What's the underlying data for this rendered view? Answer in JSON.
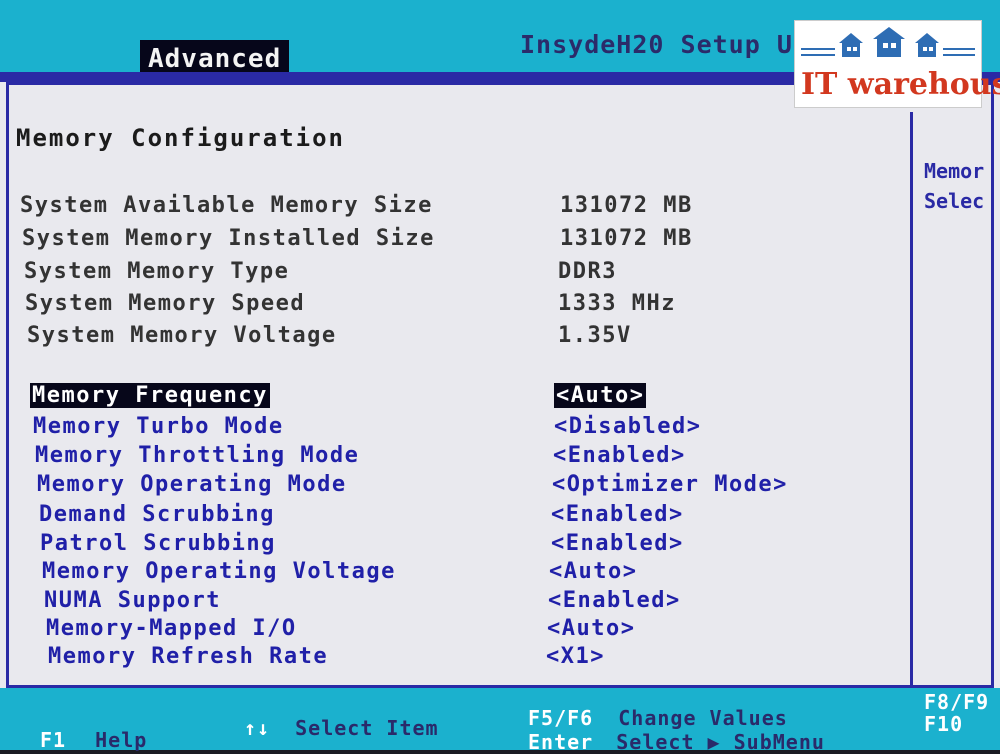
{
  "header": {
    "active_tab": "Advanced",
    "title": "InsydeH20 Setup U"
  },
  "page": {
    "section_title": "Memory Configuration",
    "help_line1": "Memor",
    "help_line2": "Selec"
  },
  "info": [
    {
      "label": "System Available Memory Size",
      "value": "131072 MB"
    },
    {
      "label": "System Memory Installed Size",
      "value": "131072 MB"
    },
    {
      "label": "System Memory Type",
      "value": "DDR3"
    },
    {
      "label": "System Memory Speed",
      "value": "1333 MHz"
    },
    {
      "label": "System Memory Voltage",
      "value": "1.35V"
    }
  ],
  "options": [
    {
      "label": "Memory Frequency",
      "value": "<Auto>"
    },
    {
      "label": "Memory Turbo Mode",
      "value": "<Disabled>"
    },
    {
      "label": "Memory Throttling Mode",
      "value": "<Enabled>"
    },
    {
      "label": "Memory Operating Mode",
      "value": "<Optimizer Mode>"
    },
    {
      "label": "Demand Scrubbing",
      "value": "<Enabled>"
    },
    {
      "label": "Patrol Scrubbing",
      "value": "<Enabled>"
    },
    {
      "label": "Memory Operating Voltage",
      "value": "<Auto>"
    },
    {
      "label": "NUMA Support",
      "value": "<Enabled>"
    },
    {
      "label": "Memory-Mapped I/O",
      "value": "<Auto>"
    },
    {
      "label": "Memory Refresh Rate",
      "value": "<X1>"
    }
  ],
  "footer": {
    "f1_key": "F1",
    "f1_label": "Help",
    "arrows_key": "↑↓",
    "arrows_label": "Select Item",
    "f5f6_key": "F5/F6",
    "f5f6_label": "Change Values",
    "enter_key": "Enter",
    "enter_label": "Select ▶ SubMenu",
    "f8f9_key": "F8/F9",
    "f10_key": "F10"
  },
  "watermark": {
    "text": "IT warehouse",
    "color": "#d2381f",
    "icon_color": "#2e6db4"
  }
}
